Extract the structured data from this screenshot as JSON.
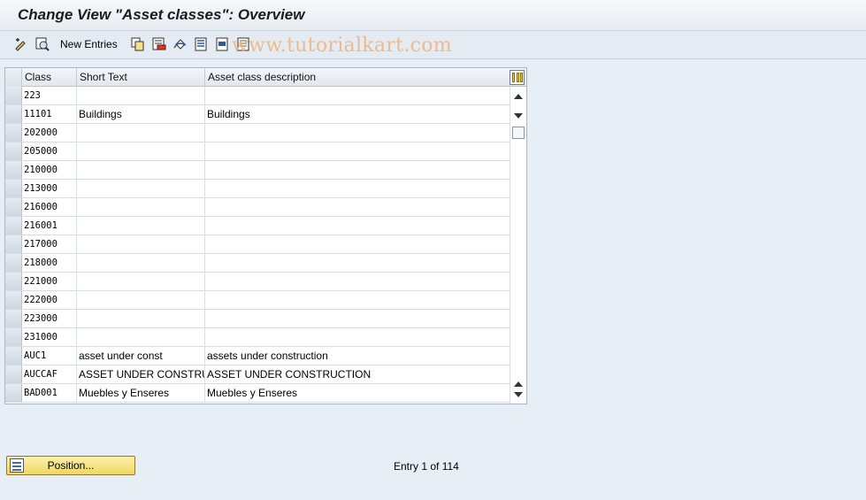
{
  "title": "Change View \"Asset classes\": Overview",
  "toolbar": {
    "new_entries_label": "New Entries",
    "watermark": "www.tutorialkart.com"
  },
  "table": {
    "columns": [
      "Class",
      "Short Text",
      "Asset class description"
    ],
    "rows": [
      {
        "class": "223",
        "short": "",
        "desc": ""
      },
      {
        "class": "11101",
        "short": "Buildings",
        "desc": "Buildings"
      },
      {
        "class": "202000",
        "short": "",
        "desc": ""
      },
      {
        "class": "205000",
        "short": "",
        "desc": ""
      },
      {
        "class": "210000",
        "short": "",
        "desc": ""
      },
      {
        "class": "213000",
        "short": "",
        "desc": ""
      },
      {
        "class": "216000",
        "short": "",
        "desc": ""
      },
      {
        "class": "216001",
        "short": "",
        "desc": ""
      },
      {
        "class": "217000",
        "short": "",
        "desc": ""
      },
      {
        "class": "218000",
        "short": "",
        "desc": ""
      },
      {
        "class": "221000",
        "short": "",
        "desc": ""
      },
      {
        "class": "222000",
        "short": "",
        "desc": ""
      },
      {
        "class": "223000",
        "short": "",
        "desc": ""
      },
      {
        "class": "231000",
        "short": "",
        "desc": ""
      },
      {
        "class": "AUC1",
        "short": "asset under const",
        "desc": "assets under construction"
      },
      {
        "class": "AUCCAF",
        "short": "ASSET UNDER CONSTRUC",
        "desc": "ASSET UNDER CONSTRUCTION"
      },
      {
        "class": "BAD001",
        "short": "Muebles y Enseres",
        "desc": "Muebles y Enseres"
      }
    ]
  },
  "position_button_label": "Position...",
  "entry_info": "Entry 1 of 114"
}
